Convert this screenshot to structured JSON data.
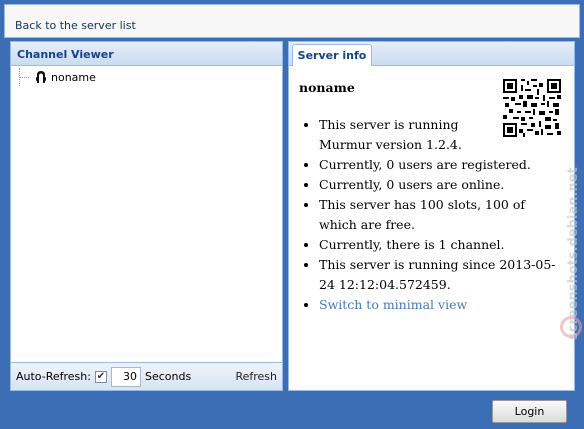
{
  "topbar": {
    "back_label": "Back to the server list"
  },
  "channel_viewer": {
    "title": "Channel Viewer",
    "tree": [
      {
        "label": "noname",
        "icon": "mumble-icon"
      }
    ]
  },
  "footer": {
    "auto_refresh_label": "Auto-Refresh:",
    "auto_refresh_checked": true,
    "seconds_value": "30",
    "seconds_label": "Seconds",
    "refresh_label": "Refresh"
  },
  "server_info": {
    "tab_label": "Server info",
    "server_name": "noname",
    "items": [
      "This server is running Murmur version 1.2.4.",
      "Currently, 0 users are registered.",
      "Currently, 0 users are online.",
      "This server has 100 slots, 100 of which are free.",
      "Currently, there is 1 channel.",
      "This server is running since 2013-05-24 12:12:04.572459."
    ],
    "link_label": "Switch to minimal view"
  },
  "login_label": "Login",
  "watermark": "screenshots.debian.net",
  "colors": {
    "background": "#3b6eb4",
    "panel_border": "#99bbe8",
    "header_text": "#15428b",
    "link": "#4a76b8"
  }
}
